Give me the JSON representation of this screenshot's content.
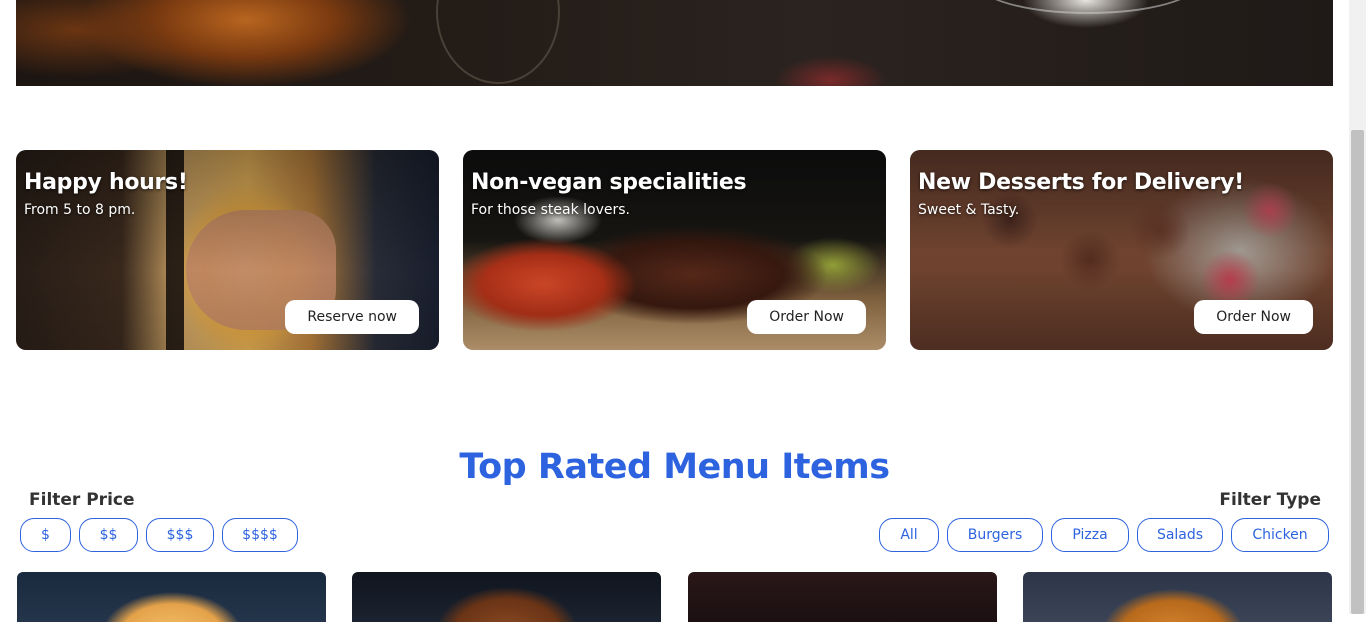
{
  "promos": [
    {
      "title": "Happy hours!",
      "subtitle": "From 5 to 8 pm.",
      "cta": "Reserve now"
    },
    {
      "title": "Non-vegan specialities",
      "subtitle": "For those steak lovers.",
      "cta": "Order Now"
    },
    {
      "title": "New Desserts for Delivery!",
      "subtitle": "Sweet & Tasty.",
      "cta": "Order Now"
    }
  ],
  "menu": {
    "title": "Top Rated Menu Items",
    "filter_price_label": "Filter Price",
    "filter_type_label": "Filter Type",
    "price_filters": [
      "$",
      "$$",
      "$$$",
      "$$$$"
    ],
    "type_filters": [
      "All",
      "Burgers",
      "Pizza",
      "Salads",
      "Chicken"
    ]
  },
  "colors": {
    "accent": "#2e63e0",
    "button_bg": "#ffffff",
    "heading_text": "#333333"
  }
}
